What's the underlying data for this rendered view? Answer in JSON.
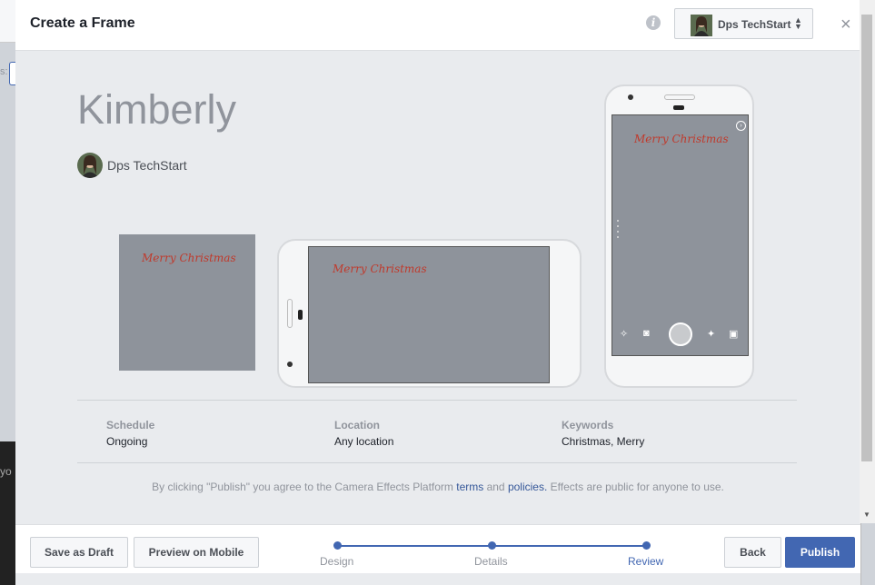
{
  "modal": {
    "title": "Create a Frame",
    "page_selector": {
      "label": "Dps TechStart"
    }
  },
  "frame": {
    "name": "Kimberly",
    "author": "Dps TechStart",
    "overlay_text": "Merry Christmas"
  },
  "details": {
    "schedule": {
      "label": "Schedule",
      "value": "Ongoing"
    },
    "location": {
      "label": "Location",
      "value": "Any location"
    },
    "keywords": {
      "label": "Keywords",
      "value": "Christmas, Merry"
    }
  },
  "legal": {
    "prefix": "By clicking \"Publish\" you agree to the Camera Effects Platform ",
    "terms": "terms",
    "and": " and ",
    "policies": "policies.",
    "suffix": " Effects are public for anyone to use."
  },
  "footer": {
    "save_draft": "Save as Draft",
    "preview_mobile": "Preview on Mobile",
    "back": "Back",
    "publish": "Publish",
    "steps": [
      "Design",
      "Details",
      "Review"
    ],
    "active_step": "Review"
  },
  "background": {
    "side_label": "s:",
    "dark_text": "yo"
  },
  "colors": {
    "primary": "#4267b2",
    "link": "#365899",
    "overlay_text": "#c0392b"
  }
}
